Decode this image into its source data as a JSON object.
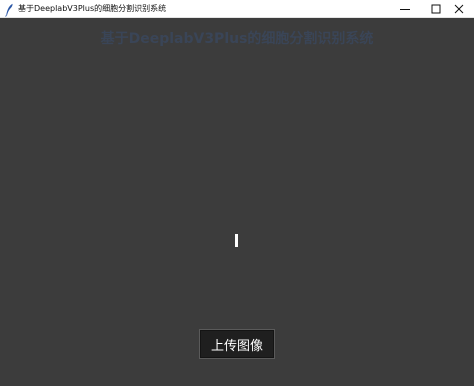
{
  "window": {
    "title": "基于DeeplabV3Plus的细胞分割识别系统",
    "controls": {
      "minimize": "minimize-icon",
      "maximize": "maximize-icon",
      "close": "close-icon"
    }
  },
  "main": {
    "heading": "基于DeeplabV3Plus的细胞分割识别系统",
    "upload_button_label": "上传图像"
  },
  "colors": {
    "background": "#3c3c3c",
    "heading": "#3a4557",
    "button_bg": "#1f1f1f",
    "button_text": "#ffffff"
  }
}
